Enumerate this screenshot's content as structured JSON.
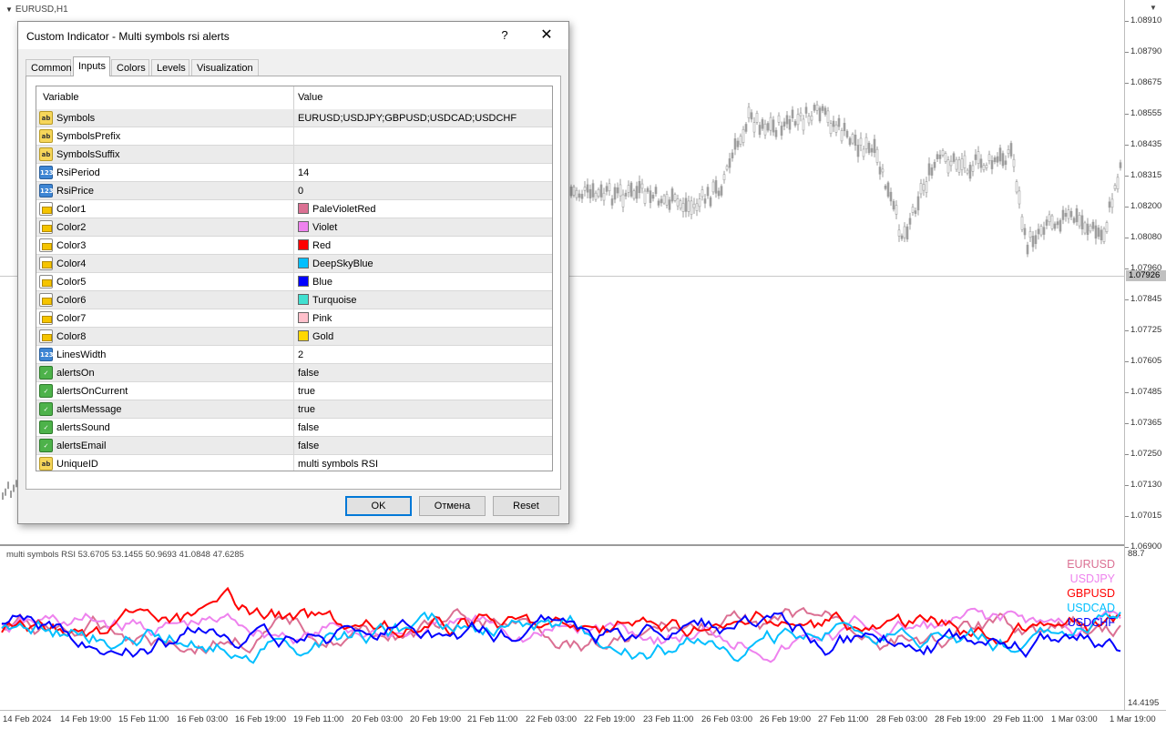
{
  "chart": {
    "symbol_title": "EURUSD,H1",
    "current_price": "1.07926",
    "price_labels": [
      "1.08910",
      "1.08790",
      "1.08675",
      "1.08555",
      "1.08435",
      "1.08315",
      "1.08200",
      "1.08080",
      "1.07960",
      "1.07845",
      "1.07725",
      "1.07605",
      "1.07485",
      "1.07365",
      "1.07250",
      "1.07130",
      "1.07015",
      "1.06900"
    ],
    "time_labels": [
      "14 Feb 2024",
      "14 Feb 19:00",
      "15 Feb 11:00",
      "16 Feb 03:00",
      "16 Feb 19:00",
      "19 Feb 11:00",
      "20 Feb 03:00",
      "20 Feb 19:00",
      "21 Feb 11:00",
      "22 Feb 03:00",
      "22 Feb 19:00",
      "23 Feb 11:00",
      "26 Feb 03:00",
      "26 Feb 19:00",
      "27 Feb 11:00",
      "28 Feb 03:00",
      "28 Feb 19:00",
      "29 Feb 11:00",
      "1 Mar 03:00",
      "1 Mar 19:00"
    ],
    "candle_color": "#9e9e9e"
  },
  "subwindow": {
    "title": "multi symbols RSI 53.6705 53.1455 50.9693 41.0848 47.6285",
    "scale_max": "88.7",
    "scale_min": "14.4195",
    "legend": [
      {
        "name": "EURUSD",
        "color": "#DB7093"
      },
      {
        "name": "USDJPY",
        "color": "#EE82EE"
      },
      {
        "name": "GBPUSD",
        "color": "#FF0000"
      },
      {
        "name": "USDCAD",
        "color": "#00BFFF"
      },
      {
        "name": "USDCHF",
        "color": "#0000FF"
      }
    ]
  },
  "dialog": {
    "title": "Custom Indicator - Multi symbols rsi  alerts",
    "help_glyph": "?",
    "close_glyph": "✕",
    "tabs": [
      {
        "label": "Common",
        "active": false
      },
      {
        "label": "Inputs",
        "active": true
      },
      {
        "label": "Colors",
        "active": false
      },
      {
        "label": "Levels",
        "active": false
      },
      {
        "label": "Visualization",
        "active": false
      }
    ],
    "grid": {
      "col_variable": "Variable",
      "col_value": "Value",
      "rows": [
        {
          "type": "ab",
          "type_icon": "string-type-icon",
          "name": "Symbols",
          "value": "EURUSD;USDJPY;GBPUSD;USDCAD;USDCHF"
        },
        {
          "type": "ab",
          "type_icon": "string-type-icon",
          "name": "SymbolsPrefix",
          "value": ""
        },
        {
          "type": "ab",
          "type_icon": "string-type-icon",
          "name": "SymbolsSuffix",
          "value": ""
        },
        {
          "type": "num",
          "type_icon": "integer-type-icon",
          "name": "RsiPeriod",
          "value": "14"
        },
        {
          "type": "num",
          "type_icon": "integer-type-icon",
          "name": "RsiPrice",
          "value": "0"
        },
        {
          "type": "clr",
          "type_icon": "color-type-icon",
          "name": "Color1",
          "value": "PaleVioletRed",
          "swatch": "#DB7093"
        },
        {
          "type": "clr",
          "type_icon": "color-type-icon",
          "name": "Color2",
          "value": "Violet",
          "swatch": "#EE82EE"
        },
        {
          "type": "clr",
          "type_icon": "color-type-icon",
          "name": "Color3",
          "value": "Red",
          "swatch": "#FF0000"
        },
        {
          "type": "clr",
          "type_icon": "color-type-icon",
          "name": "Color4",
          "value": "DeepSkyBlue",
          "swatch": "#00BFFF"
        },
        {
          "type": "clr",
          "type_icon": "color-type-icon",
          "name": "Color5",
          "value": "Blue",
          "swatch": "#0000FF"
        },
        {
          "type": "clr",
          "type_icon": "color-type-icon",
          "name": "Color6",
          "value": "Turquoise",
          "swatch": "#40E0D0"
        },
        {
          "type": "clr",
          "type_icon": "color-type-icon",
          "name": "Color7",
          "value": "Pink",
          "swatch": "#FFC0CB"
        },
        {
          "type": "clr",
          "type_icon": "color-type-icon",
          "name": "Color8",
          "value": "Gold",
          "swatch": "#FFD700"
        },
        {
          "type": "num",
          "type_icon": "integer-type-icon",
          "name": "LinesWidth",
          "value": "2"
        },
        {
          "type": "bool",
          "type_icon": "boolean-type-icon",
          "name": "alertsOn",
          "value": "false"
        },
        {
          "type": "bool",
          "type_icon": "boolean-type-icon",
          "name": "alertsOnCurrent",
          "value": "true"
        },
        {
          "type": "bool",
          "type_icon": "boolean-type-icon",
          "name": "alertsMessage",
          "value": "true"
        },
        {
          "type": "bool",
          "type_icon": "boolean-type-icon",
          "name": "alertsSound",
          "value": "false"
        },
        {
          "type": "bool",
          "type_icon": "boolean-type-icon",
          "name": "alertsEmail",
          "value": "false"
        },
        {
          "type": "ab",
          "type_icon": "string-type-icon",
          "name": "UniqueID",
          "value": "multi symbols RSI"
        }
      ]
    },
    "buttons": {
      "ok": "OK",
      "cancel": "Отмена",
      "reset": "Reset"
    }
  }
}
